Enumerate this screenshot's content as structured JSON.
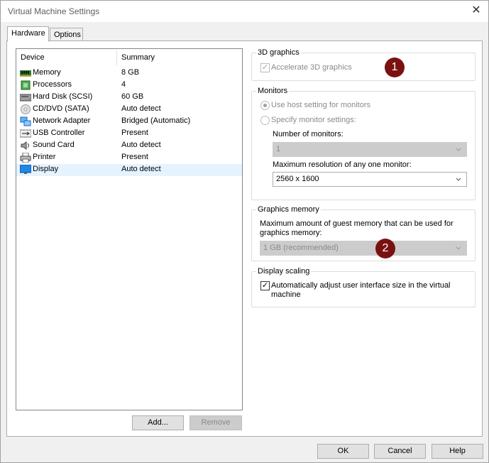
{
  "window": {
    "title": "Virtual Machine Settings",
    "close_glyph": "✕"
  },
  "tabs": [
    {
      "label": "Hardware"
    },
    {
      "label": "Options"
    }
  ],
  "device_list": {
    "columns": [
      "Device",
      "Summary"
    ],
    "rows": [
      {
        "name": "Memory",
        "summary": "8 GB",
        "icon": "memory-icon"
      },
      {
        "name": "Processors",
        "summary": "4",
        "icon": "processor-icon"
      },
      {
        "name": "Hard Disk (SCSI)",
        "summary": "60 GB",
        "icon": "hard-disk-icon"
      },
      {
        "name": "CD/DVD (SATA)",
        "summary": "Auto detect",
        "icon": "cd-dvd-icon"
      },
      {
        "name": "Network Adapter",
        "summary": "Bridged (Automatic)",
        "icon": "network-adapter-icon"
      },
      {
        "name": "USB Controller",
        "summary": "Present",
        "icon": "usb-icon"
      },
      {
        "name": "Sound Card",
        "summary": "Auto detect",
        "icon": "sound-card-icon"
      },
      {
        "name": "Printer",
        "summary": "Present",
        "icon": "printer-icon"
      },
      {
        "name": "Display",
        "summary": "Auto detect",
        "icon": "display-icon",
        "selected": true
      }
    ]
  },
  "list_buttons": {
    "add": "Add...",
    "remove": "Remove"
  },
  "graphics3d": {
    "title": "3D graphics",
    "accelerate_label": "Accelerate 3D graphics",
    "accelerate_checked": true,
    "badge": "1"
  },
  "monitors": {
    "title": "Monitors",
    "use_host_label": "Use host setting for monitors",
    "specify_label": "Specify monitor settings:",
    "number_label": "Number of monitors:",
    "number_value": "1",
    "max_res_label": "Maximum resolution of any one monitor:",
    "max_res_value": "2560 x 1600"
  },
  "graphics_memory": {
    "title": "Graphics memory",
    "description_line1": "Maximum amount of guest memory that can be used for",
    "description_line2": "graphics memory:",
    "value": "1 GB (recommended)",
    "badge": "2"
  },
  "display_scaling": {
    "title": "Display scaling",
    "auto_adjust_line1": "Automatically adjust user interface size in the virtual",
    "auto_adjust_line2": "machine",
    "auto_adjust_checked": true
  },
  "footer": {
    "ok": "OK",
    "cancel": "Cancel",
    "help": "Help"
  },
  "colors": {
    "badge": "#7a1111",
    "selected_row": "#e5f3ff"
  }
}
